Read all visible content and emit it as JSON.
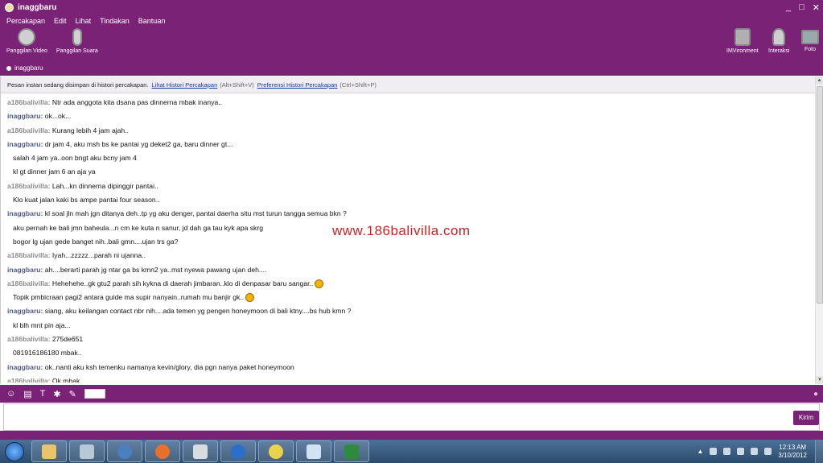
{
  "window": {
    "title": "inaggbaru",
    "controls": [
      "_",
      "□",
      "✕"
    ]
  },
  "menu": [
    "Percakapan",
    "Edit",
    "Lihat",
    "Tindakan",
    "Bantuan"
  ],
  "toolbar": {
    "video_call": "Panggilan Video",
    "voice_call": "Panggilan Suara",
    "imvironment": "IMVironment",
    "interaksi": "Interaksi",
    "foto": "Foto"
  },
  "status": {
    "name": "inaggbaru"
  },
  "infobar": {
    "text": "Pesan instan sedang disimpan di histori percakapan.",
    "link1": "Lihat Histori Percakapan",
    "key1": "(Alt+Shift+V)",
    "link2": "Preferensi Histori Percakapan",
    "key2": "(Ctrl+Shift+P)"
  },
  "messages": [
    {
      "sender": "a186balivilla:",
      "who": "a",
      "text": " Ntr ada anggota kita dsana pas dinnerna mbak inanya.."
    },
    {
      "sender": "inaggbaru:",
      "who": "b",
      "text": " ok...ok..."
    },
    {
      "sender": "a186balivilla:",
      "who": "a",
      "text": " Kurang lebih 4 jam ajah.."
    },
    {
      "sender": "inaggbaru:",
      "who": "b",
      "text": " dr jam 4, aku msh bs ke pantai yg deket2 ga, baru dinner gt..."
    },
    {
      "sender": "",
      "who": "c",
      "text": "salah 4 jam ya..oon bngt aku bcny jam 4"
    },
    {
      "sender": "",
      "who": "c",
      "text": "kl gt dinner jam 6 an aja ya"
    },
    {
      "sender": "a186balivilla:",
      "who": "a",
      "text": " Lah...kn dinnerna dipinggir pantai.."
    },
    {
      "sender": "",
      "who": "c",
      "text": "Klo kuat jalan kaki bs ampe pantai four season.."
    },
    {
      "sender": "inaggbaru:",
      "who": "b",
      "text": " kl soal jln mah jgn ditanya deh..tp yg aku denger, pantai daerha situ mst turun tangga semua bkn ?"
    },
    {
      "sender": "",
      "who": "c",
      "text": "aku pernah ke bali jmn baheula...n cm ke kuta n sanur, jd dah ga tau kyk apa skrg"
    },
    {
      "sender": "",
      "who": "c",
      "text": "bogor lg ujan gede banget nih..bali gmn....ujan trs ga?"
    },
    {
      "sender": "a186balivilla:",
      "who": "a",
      "text": " Iyah...zzzzz...parah ni ujanna.."
    },
    {
      "sender": "inaggbaru:",
      "who": "b",
      "text": " ah....berarti parah jg ntar ga bs kmn2 ya..mst nyewa pawang ujan deh...."
    },
    {
      "sender": "a186balivilla:",
      "who": "a",
      "text": " Hehehehe..gk gtu2 parah sih kykna di daerah jimbaran..klo di denpasar baru sangar..",
      "emo": true
    },
    {
      "sender": "",
      "who": "c",
      "text": "Topik pmbicraan pagi2 antara guide ma supir nanyain..rumah mu banjir gk..",
      "emo": true
    },
    {
      "sender": "inaggbaru:",
      "who": "b",
      "text": " siang, aku keilangan contact nbr nih....ada temen yg pengen honeymoon di bali ktny....bs hub kmn ?"
    },
    {
      "sender": "",
      "who": "c",
      "text": "kl blh mnt pin aja..."
    },
    {
      "sender": "a186balivilla:",
      "who": "a",
      "text": " 275de651"
    },
    {
      "sender": "",
      "who": "c",
      "text": "081916186180 mbak.."
    },
    {
      "sender": "inaggbaru:",
      "who": "b",
      "text": " ok..nanti aku ksh temenku namanya kevin/glory, dia pgn nanya paket honeymoon"
    },
    {
      "sender": "a186balivilla:",
      "who": "a",
      "text": " Ok mbak.."
    }
  ],
  "watermark": "www.186balivilla.com",
  "send_button": "Kirim",
  "taskbar": {
    "time": "12:13 AM",
    "date": "3/10/2012"
  }
}
